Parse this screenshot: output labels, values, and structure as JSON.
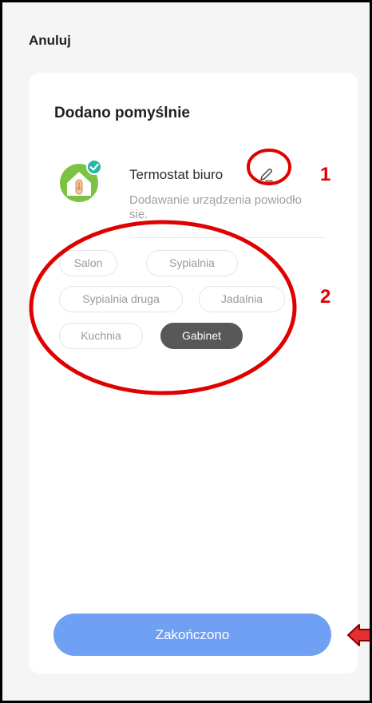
{
  "header": {
    "cancel_label": "Anuluj"
  },
  "card": {
    "title": "Dodano pomyślnie",
    "device": {
      "name": "Termostat biuro",
      "message": "Dodawanie urządzenia powiodło się.",
      "icon": "thermostat-home-icon",
      "check_icon": "check-badge-icon",
      "edit_icon": "pencil-icon"
    },
    "rooms": [
      {
        "label": "Salon",
        "selected": false
      },
      {
        "label": "Sypialnia",
        "selected": false
      },
      {
        "label": "Sypialnia druga",
        "selected": false
      },
      {
        "label": "Jadalnia",
        "selected": false
      },
      {
        "label": "Kuchnia",
        "selected": false
      },
      {
        "label": "Gabinet",
        "selected": true
      }
    ],
    "done_label": "Zakończono"
  },
  "annotations": {
    "marker_1": "1",
    "marker_2": "2",
    "arrow_icon": "left-arrow-icon",
    "color": "#e00000"
  },
  "colors": {
    "accent_button": "#6fa0f4",
    "selected_chip": "#585858",
    "icon_green": "#7cc243"
  }
}
